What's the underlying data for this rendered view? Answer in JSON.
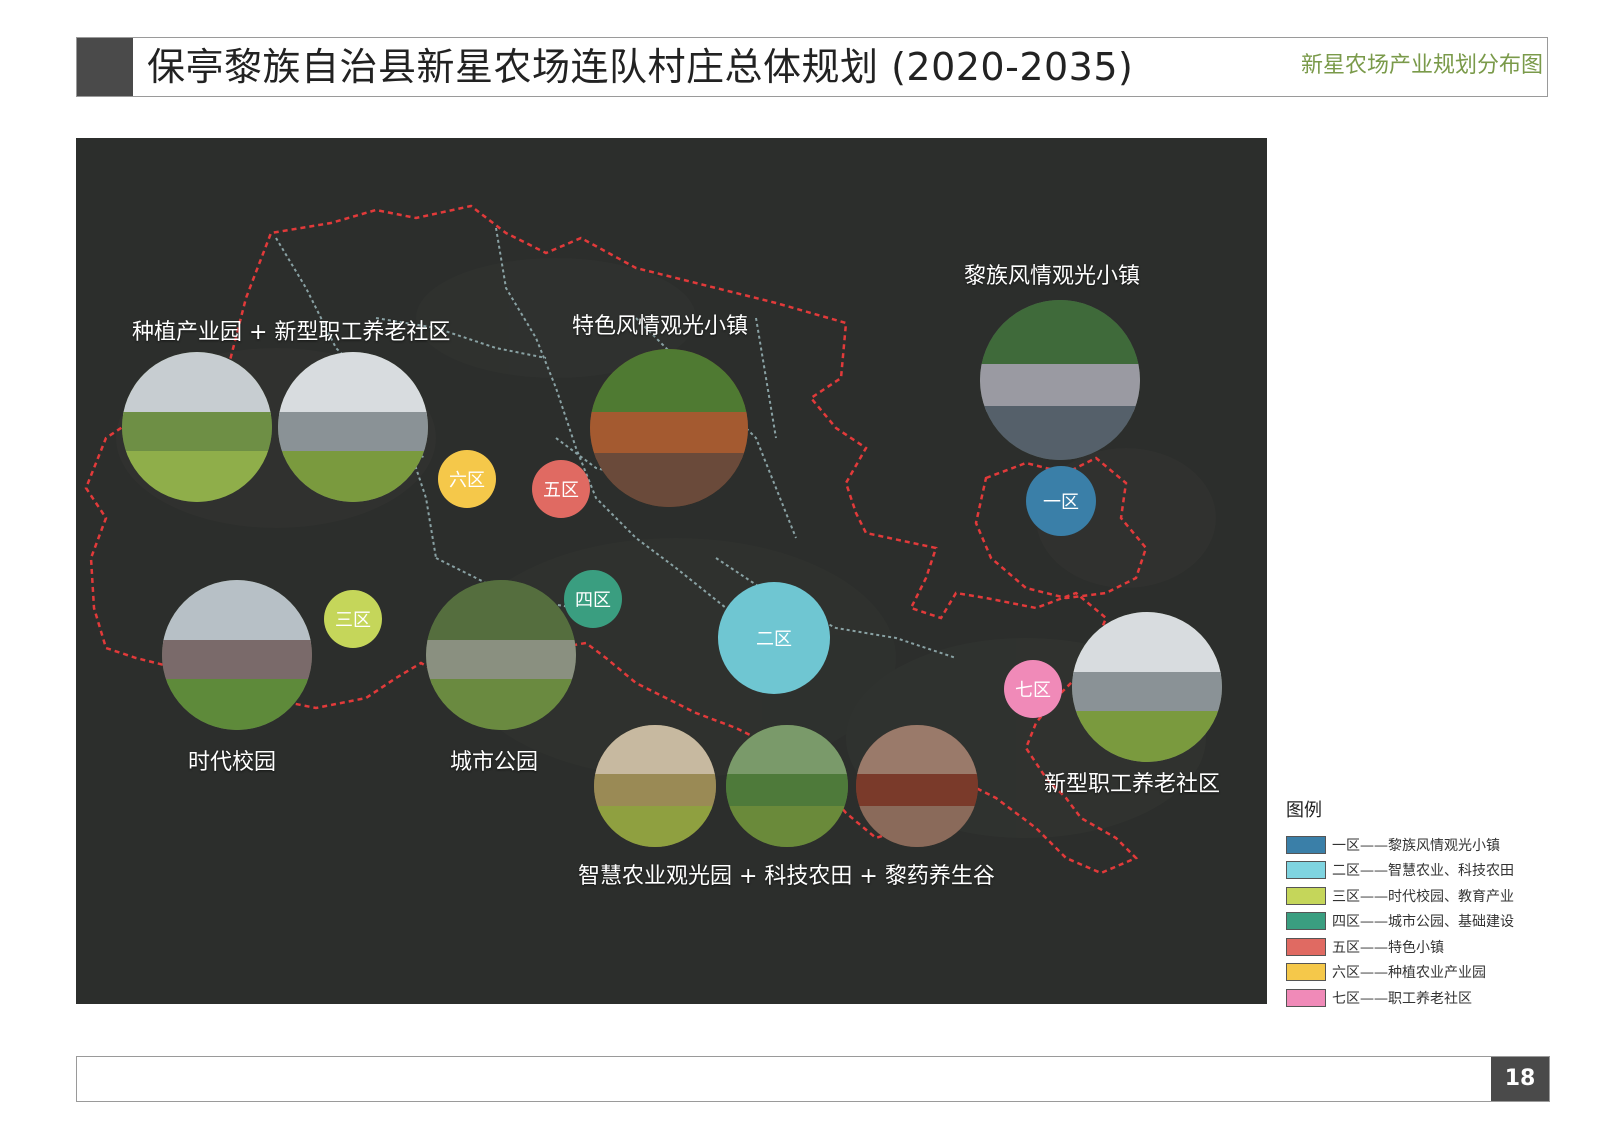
{
  "header": {
    "title": "保亭黎族自治县新星农场连队村庄总体规划 (2020-2035)",
    "subtitle": "新星农场产业规划分布图"
  },
  "map": {
    "labels": {
      "planting": "种植产业园 + 新型职工养老社区",
      "feature_town": "特色风情观光小镇",
      "li_town": "黎族风情观光小镇",
      "campus": "时代校园",
      "park": "城市公园",
      "smart_ag": "智慧农业观光园 + 科技农田 + 黎药养生谷",
      "elder": "新型职工养老社区"
    },
    "zones": {
      "z1": "一区",
      "z2": "二区",
      "z3": "三区",
      "z4": "四区",
      "z5": "五区",
      "z6": "六区",
      "z7": "七区"
    }
  },
  "legend": {
    "title": "图例",
    "items": [
      {
        "label": "一区——黎族风情观光小镇",
        "color": "#3a7fa8"
      },
      {
        "label": "二区——智慧农业、科技农田",
        "color": "#7fd4e0"
      },
      {
        "label": "三区——时代校园、教育产业",
        "color": "#c5d65a"
      },
      {
        "label": "四区——城市公园、基础建设",
        "color": "#3a9e80"
      },
      {
        "label": "五区——特色小镇",
        "color": "#e06a62"
      },
      {
        "label": "六区——种植农业产业园",
        "color": "#f5c84a"
      },
      {
        "label": "七区——职工养老社区",
        "color": "#f08ab8"
      }
    ]
  },
  "footer": {
    "page_number": "18"
  },
  "colors": {
    "map_background": "#2c2e2c",
    "boundary": "#e23a3a",
    "roads": "#a8c8cc",
    "header_accent": "#4a4a4a",
    "subtitle": "#7a9a4a"
  }
}
